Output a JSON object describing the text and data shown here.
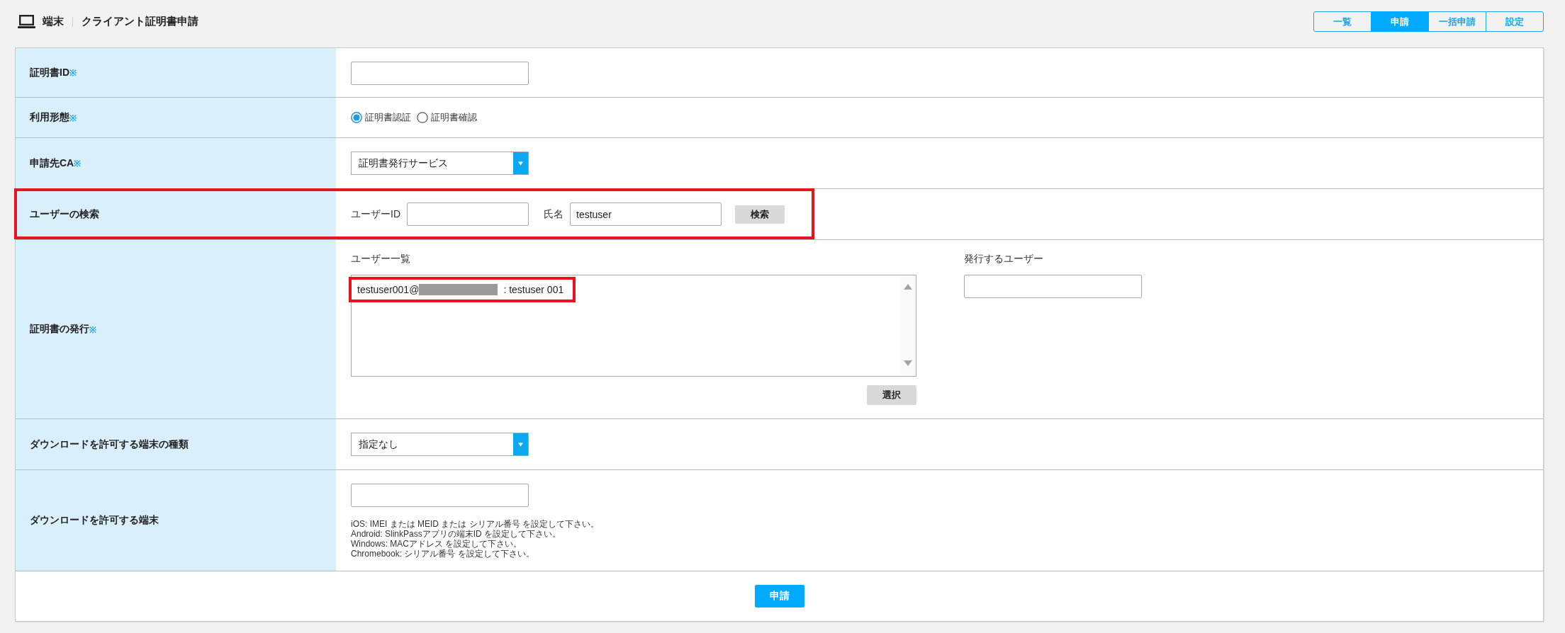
{
  "header": {
    "section": "端末",
    "title": "クライアント証明書申請"
  },
  "tabs": [
    {
      "label": "一覧",
      "selected": false
    },
    {
      "label": "申請",
      "selected": true
    },
    {
      "label": "一括申請",
      "selected": false
    },
    {
      "label": "設定",
      "selected": false
    }
  ],
  "form": {
    "rows": [
      {
        "kind": "text",
        "label": "証明書ID",
        "mark": "※",
        "highlighted": false
      },
      {
        "kind": "radio",
        "label": "利用形態",
        "mark": "※",
        "highlighted": false,
        "options": [
          {
            "label": "証明書認証",
            "selected": true
          },
          {
            "label": "証明書確認",
            "selected": false
          }
        ]
      },
      {
        "kind": "select",
        "label": "申請先CA",
        "mark": "※",
        "highlighted": false,
        "value": "証明書発行サービス"
      },
      {
        "kind": "search",
        "label": "ユーザーの検索",
        "highlighted": true,
        "fields": [
          {
            "label": "ユーザーID"
          },
          {
            "label": "氏名",
            "value": "testuser"
          }
        ],
        "button": "検索"
      },
      {
        "kind": "issue",
        "label": "証明書の発行",
        "mark": "※",
        "highlighted": false,
        "list": {
          "label": "ユーザー一覧",
          "items": [
            {
              "user_id": "testuser001@",
              "name": ": testuser 001",
              "redacted": true,
              "highlighted": true
            }
          ]
        },
        "button": "選択",
        "target": {
          "label": "発行するユーザー"
        }
      },
      {
        "kind": "select",
        "label": "ダウンロードを許可する端末の種類",
        "highlighted": false,
        "value": "指定なし"
      },
      {
        "kind": "text",
        "label": "ダウンロードを許可する端末",
        "highlighted": false,
        "help": [
          "iOS: IMEI または MEID または シリアル番号 を設定して下さい。",
          "Android: SlinkPassアプリの端末ID を設定して下さい。",
          "Windows: MACアドレス を設定して下さい。",
          "Chromebook: シリアル番号 を設定して下さい。"
        ]
      }
    ],
    "submit": "申請"
  }
}
